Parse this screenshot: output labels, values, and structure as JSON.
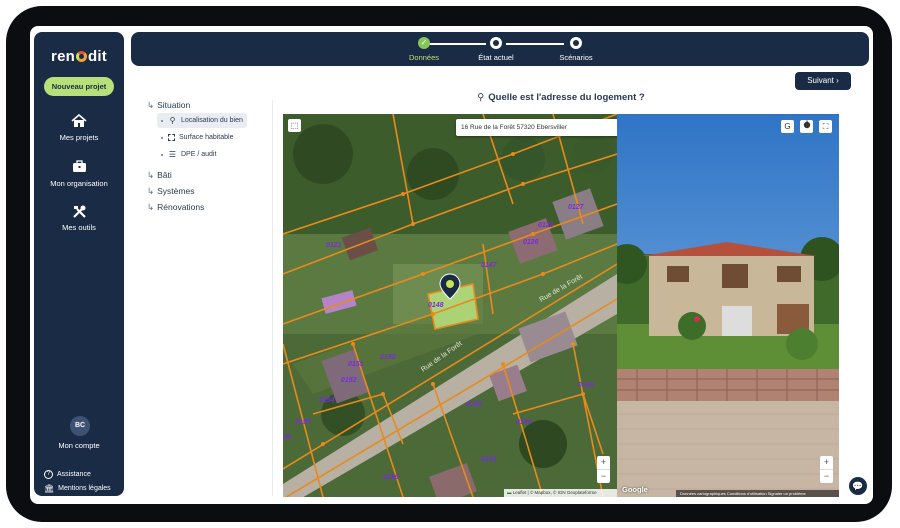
{
  "brand": {
    "logo_text_pre": "ren",
    "logo_text_post": "dit"
  },
  "sidebar": {
    "new_project_label": "Nouveau projet",
    "items": [
      {
        "label": "Mes projets",
        "icon": "house-icon"
      },
      {
        "label": "Mon organisation",
        "icon": "briefcase-icon"
      },
      {
        "label": "Mes outils",
        "icon": "tools-icon"
      }
    ],
    "account": {
      "initials": "BC",
      "label": "Mon compte"
    },
    "footer": [
      {
        "label": "Assistance",
        "icon": "help-icon"
      },
      {
        "label": "Mentions légales",
        "icon": "bank-icon"
      }
    ]
  },
  "stepper": {
    "steps": [
      {
        "label": "Données",
        "state": "done"
      },
      {
        "label": "État actuel",
        "state": "current"
      },
      {
        "label": "Scénarios",
        "state": "current"
      }
    ],
    "accent": "#86c557"
  },
  "next_button": {
    "label": "Suivant",
    "icon": "chevron-right-icon"
  },
  "tree": {
    "sections": [
      {
        "label": "Situation"
      },
      {
        "label": "Bâti"
      },
      {
        "label": "Systèmes"
      },
      {
        "label": "Rénovations"
      }
    ],
    "sub_items": [
      {
        "label": "Localisation du bien",
        "icon": "pin-icon",
        "selected": true
      },
      {
        "label": "Surface habitable",
        "icon": "area-icon",
        "selected": false
      },
      {
        "label": "DPE / audit",
        "icon": "dpe-icon",
        "selected": false
      }
    ]
  },
  "question": {
    "text": "Quelle est l'adresse du logement ?",
    "icon": "pin-icon"
  },
  "address": {
    "value": "16 Rue de la Forêt 57320 Ebersviller"
  },
  "map": {
    "parcels": [
      "0121",
      "0128",
      "0127",
      "0126",
      "0147",
      "0148",
      "0150",
      "0151",
      "0152",
      "0154",
      "0155",
      "0140",
      "0194",
      "0195",
      "0141",
      "0146",
      "36"
    ],
    "street_label": "Rue de la Forêt",
    "attribution": "Leaflet | © Mapbox, © IGN Geoplateforme",
    "zoom_in": "+",
    "zoom_out": "−"
  },
  "street_view": {
    "attribution": "Données cartographiques   Conditions d'utilisation   Signaler un problème",
    "brand": "Google",
    "zoom_in": "+",
    "zoom_out": "−",
    "buttons": [
      "G",
      "",
      "⛶"
    ]
  },
  "colors": {
    "primary": "#1a2b45",
    "accent_green": "#b8e07a",
    "parcel_orange": "#e88b1c",
    "parcel_label": "#7b2be0"
  }
}
